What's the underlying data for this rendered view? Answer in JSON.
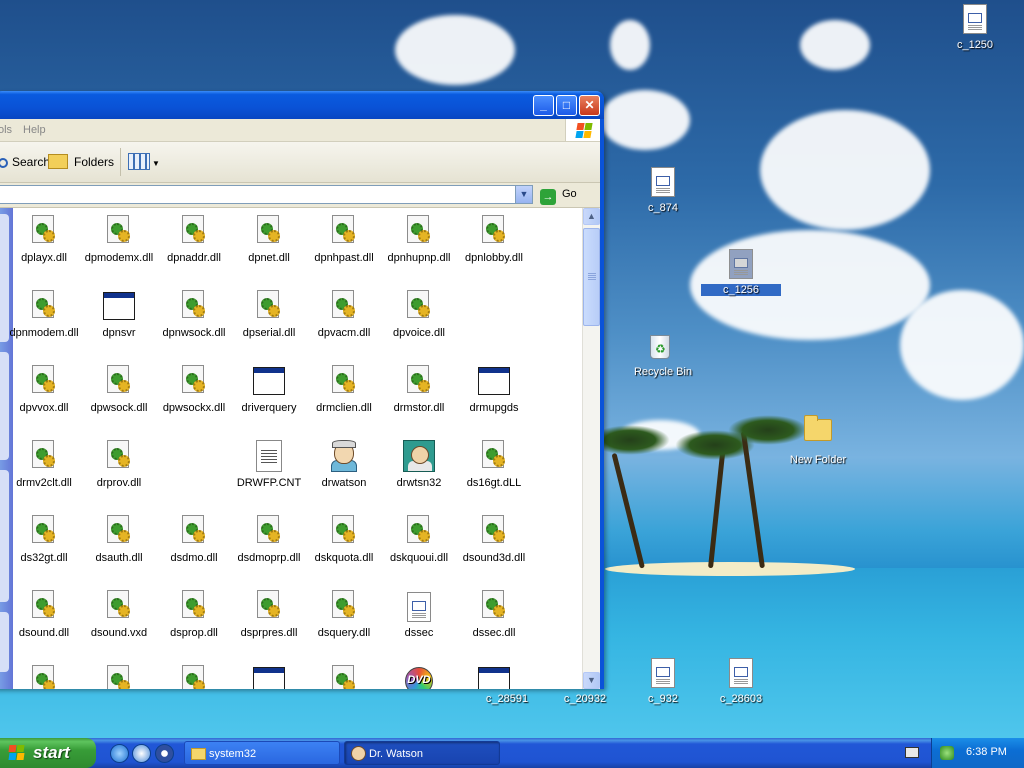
{
  "desktop": {
    "icons": [
      {
        "label": "c_1250"
      },
      {
        "label": "c_874"
      },
      {
        "label": "c_1256"
      },
      {
        "label": "Recycle Bin"
      },
      {
        "label": "New Folder"
      },
      {
        "label": "c_28591"
      },
      {
        "label": "c_20932"
      },
      {
        "label": "c_932"
      },
      {
        "label": "c_28603"
      }
    ]
  },
  "explorer": {
    "menu": {
      "tools_partial": "ols",
      "help": "Help"
    },
    "toolbar": {
      "search": "Search",
      "folders": "Folders"
    },
    "address": {
      "go": "Go"
    },
    "files": [
      {
        "name": "dplayx.dll",
        "type": "dll"
      },
      {
        "name": "dpmodemx.dll",
        "type": "dll"
      },
      {
        "name": "dpnaddr.dll",
        "type": "dll"
      },
      {
        "name": "dpnet.dll",
        "type": "dll"
      },
      {
        "name": "dpnhpast.dll",
        "type": "dll"
      },
      {
        "name": "dpnhupnp.dll",
        "type": "dll"
      },
      {
        "name": "dpnlobby.dll",
        "type": "dll"
      },
      {
        "name": "dpnmodem.dll",
        "type": "dll"
      },
      {
        "name": "dpnsvr",
        "type": "exe"
      },
      {
        "name": "dpnwsock.dll",
        "type": "dll"
      },
      {
        "name": "dpserial.dll",
        "type": "dll"
      },
      {
        "name": "dpvacm.dll",
        "type": "dll"
      },
      {
        "name": "dpvoice.dll",
        "type": "dll"
      },
      {
        "name": "",
        "type": "none"
      },
      {
        "name": "dpvvox.dll",
        "type": "dll"
      },
      {
        "name": "dpwsock.dll",
        "type": "dll"
      },
      {
        "name": "dpwsockx.dll",
        "type": "dll"
      },
      {
        "name": "driverquery",
        "type": "exe"
      },
      {
        "name": "drmclien.dll",
        "type": "dll"
      },
      {
        "name": "drmstor.dll",
        "type": "dll"
      },
      {
        "name": "drmupgds",
        "type": "exe"
      },
      {
        "name": "drmv2clt.dll",
        "type": "dll"
      },
      {
        "name": "drprov.dll",
        "type": "dll"
      },
      {
        "name": "",
        "type": "none"
      },
      {
        "name": "DRWFP.CNT",
        "type": "cnt"
      },
      {
        "name": "drwatson",
        "type": "drwatson"
      },
      {
        "name": "drwtsn32",
        "type": "drwtsn"
      },
      {
        "name": "ds16gt.dLL",
        "type": "dll"
      },
      {
        "name": "ds32gt.dll",
        "type": "dll"
      },
      {
        "name": "dsauth.dll",
        "type": "dll"
      },
      {
        "name": "dsdmo.dll",
        "type": "dll"
      },
      {
        "name": "dsdmoprp.dll",
        "type": "dll"
      },
      {
        "name": "dskquota.dll",
        "type": "dll"
      },
      {
        "name": "dskquoui.dll",
        "type": "dll"
      },
      {
        "name": "dsound3d.dll",
        "type": "dll"
      },
      {
        "name": "dsound.dll",
        "type": "dll"
      },
      {
        "name": "dsound.vxd",
        "type": "dll"
      },
      {
        "name": "dsprop.dll",
        "type": "dll"
      },
      {
        "name": "dsprpres.dll",
        "type": "dll"
      },
      {
        "name": "dsquery.dll",
        "type": "dll"
      },
      {
        "name": "dssec",
        "type": "doc"
      },
      {
        "name": "dssec.dll",
        "type": "dll"
      },
      {
        "name": "",
        "type": "dll"
      },
      {
        "name": "",
        "type": "dll"
      },
      {
        "name": "",
        "type": "dll"
      },
      {
        "name": "",
        "type": "exe"
      },
      {
        "name": "",
        "type": "dll"
      },
      {
        "name": "",
        "type": "dvd"
      },
      {
        "name": "",
        "type": "exe"
      }
    ]
  },
  "taskbar": {
    "start": "start",
    "tasks": [
      {
        "label": "system32"
      },
      {
        "label": "Dr. Watson"
      }
    ],
    "clock": "6:38 PM"
  }
}
